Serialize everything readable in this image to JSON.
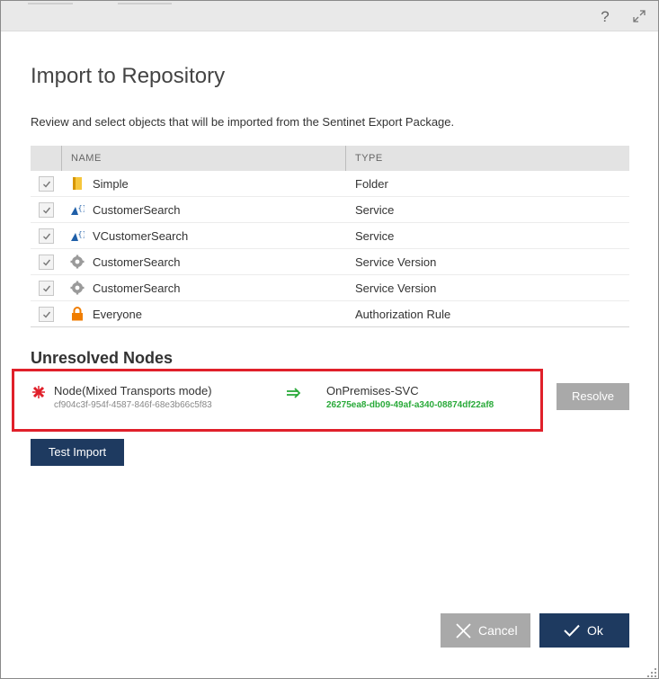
{
  "dialog": {
    "help_glyph": "?",
    "title": "Import to Repository",
    "subtitle": "Review and select objects that will be imported from the Sentinet Export Package."
  },
  "grid": {
    "columns": {
      "name": "NAME",
      "type": "TYPE"
    },
    "rows": [
      {
        "checked": true,
        "icon": "folder-icon",
        "name": "Simple",
        "type": "Folder"
      },
      {
        "checked": true,
        "icon": "service-icon",
        "name": "CustomerSearch",
        "type": "Service"
      },
      {
        "checked": true,
        "icon": "service-icon",
        "name": "VCustomerSearch",
        "type": "Service"
      },
      {
        "checked": true,
        "icon": "gear-icon",
        "name": "CustomerSearch",
        "type": "Service Version"
      },
      {
        "checked": true,
        "icon": "gear-icon",
        "name": "CustomerSearch",
        "type": "Service Version"
      },
      {
        "checked": true,
        "icon": "lock-icon",
        "name": "Everyone",
        "type": "Authorization Rule"
      }
    ]
  },
  "unresolved": {
    "heading": "Unresolved Nodes",
    "node_name": "Node(Mixed Transports mode)",
    "node_id": "cf904c3f-954f-4587-846f-68e3b66c5f83",
    "target_name": "OnPremises-SVC",
    "target_id": "26275ea8-db09-49af-a340-08874df22af8",
    "resolve_label": "Resolve"
  },
  "buttons": {
    "test_import": "Test Import",
    "cancel": "Cancel",
    "ok": "Ok"
  },
  "colors": {
    "primary": "#1e3a60",
    "disabled": "#a9a9a9",
    "highlight_border": "#e0202a",
    "success": "#2aaa3a",
    "error": "#e0202a"
  }
}
